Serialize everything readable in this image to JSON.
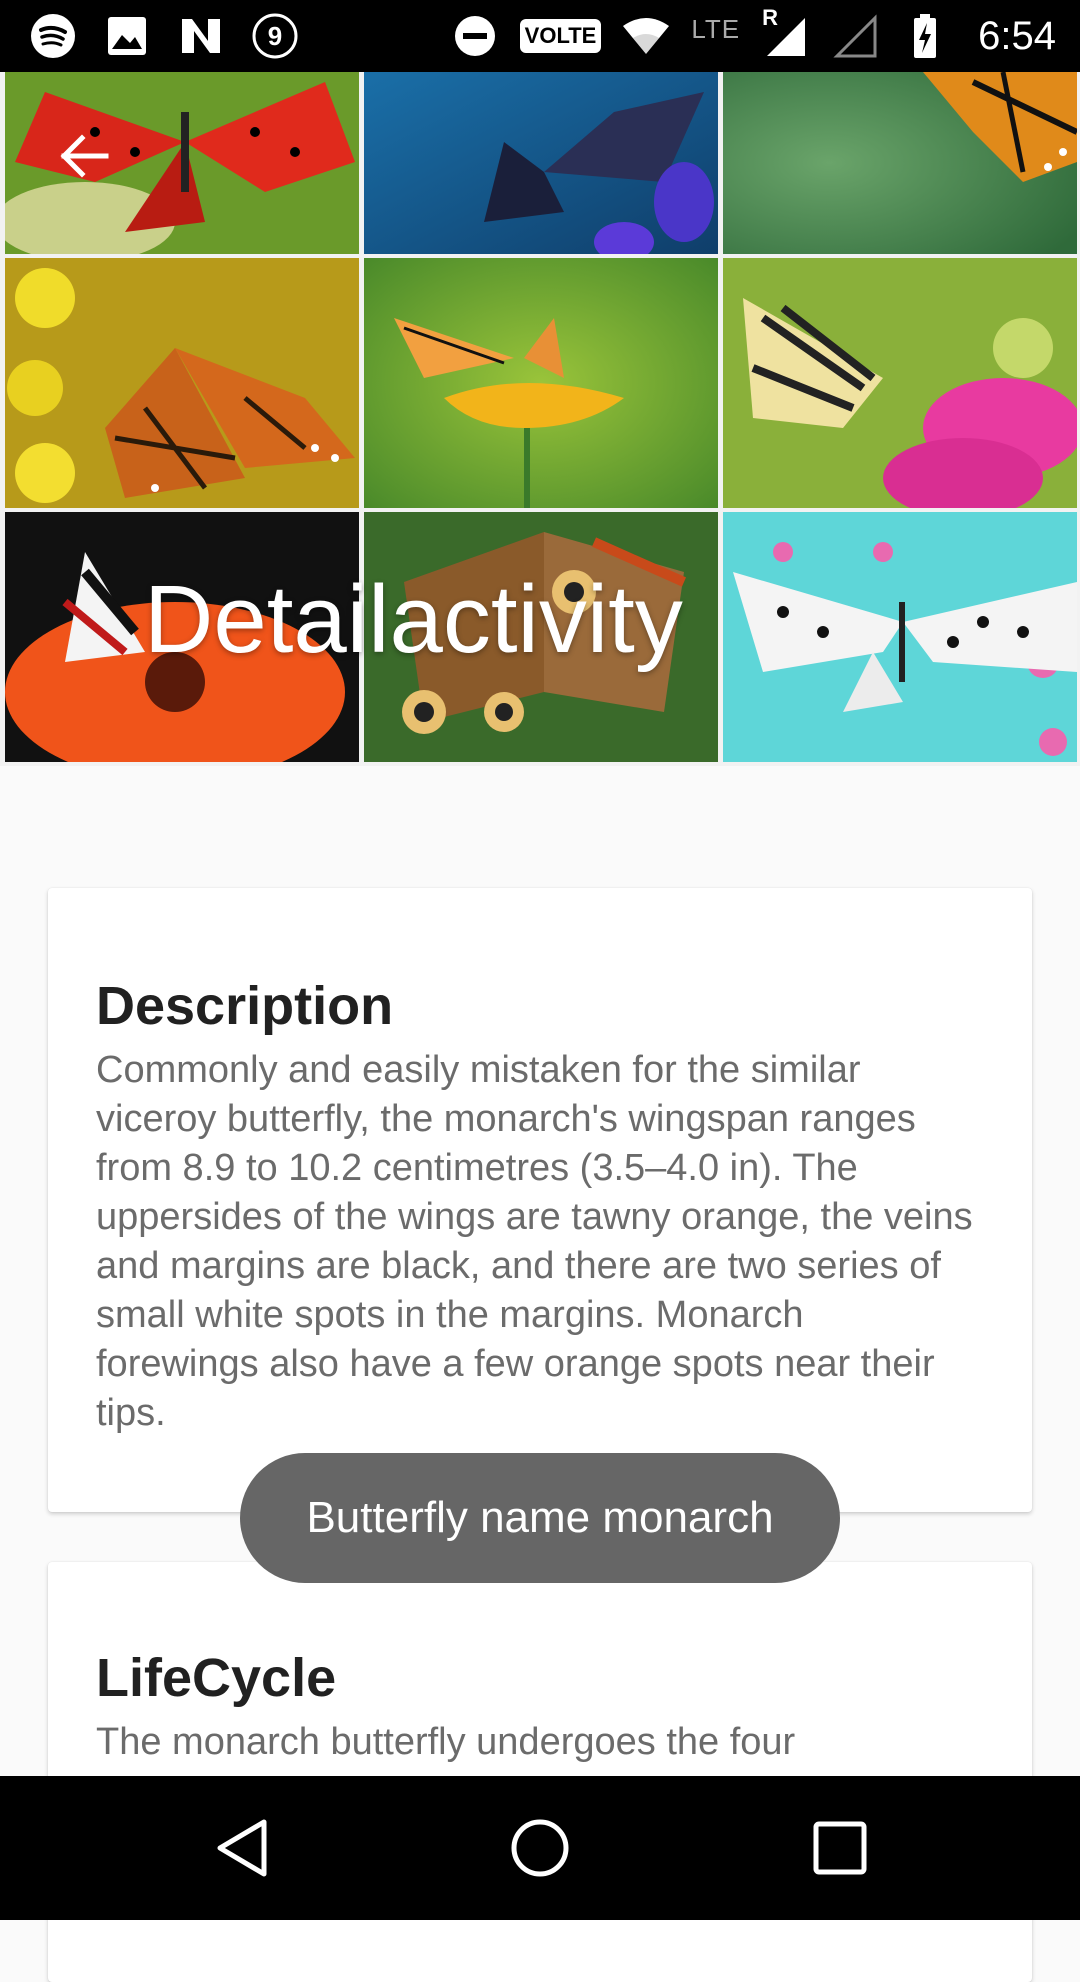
{
  "status_bar": {
    "notification_icons": [
      "spotify-icon",
      "image-icon",
      "n-app-icon",
      "notification-count-icon"
    ],
    "notification_count": "9",
    "volte_label": "VOLTE",
    "lte_label": "LTE",
    "roaming_label": "R",
    "time": "6:54"
  },
  "header": {
    "title": "Detailactivity",
    "back_icon": "arrow-left-icon"
  },
  "description_card": {
    "title": "Description",
    "body": "Commonly and easily mistaken for the similar viceroy butterfly, the monarch's wingspan ranges from 8.9 to 10.2 centimetres (3.5–4.0 in).  The uppersides of the wings are tawny orange, the veins and margins are black, and there are two series of small white spots in the margins. Monarch forewings also have a few orange spots near their tips."
  },
  "lifecycle_card": {
    "title": "LifeCycle",
    "body": "The monarch butterfly undergoes the four"
  },
  "toast": {
    "text": "Butterfly name monarch"
  },
  "nav_bar": {
    "icons": [
      "back-triangle-icon",
      "home-circle-icon",
      "recents-square-icon"
    ]
  },
  "colors": {
    "status_bar_bg": "#000000",
    "card_title": "#212121",
    "card_body": "#6b6b6b",
    "toast_bg": "#666666",
    "page_bg": "#fafafa"
  }
}
